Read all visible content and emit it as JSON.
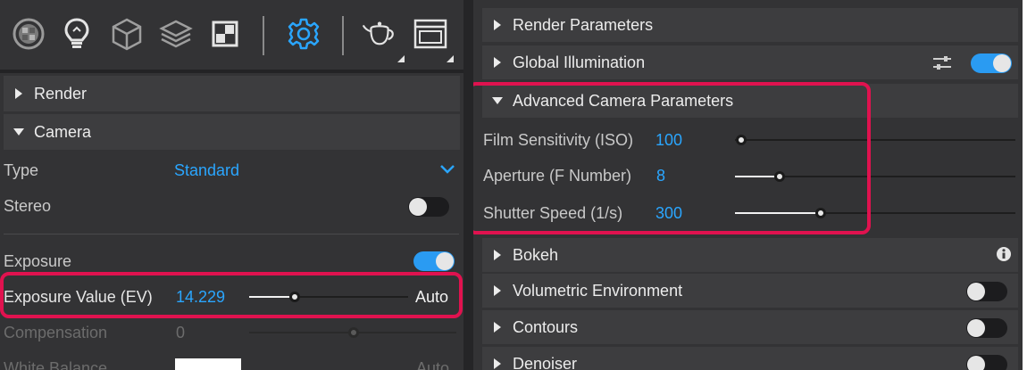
{
  "toolbar": {
    "icons": [
      "materials-icon",
      "lightbulb-icon",
      "cube-icon",
      "layers-icon",
      "texture-icon",
      "gear-icon",
      "teapot-icon",
      "window-icon"
    ]
  },
  "left": {
    "sections": {
      "render": "Render",
      "camera": "Camera"
    },
    "type": {
      "label": "Type",
      "value": "Standard"
    },
    "stereo": {
      "label": "Stereo",
      "enabled": false
    },
    "exposure": {
      "label": "Exposure",
      "enabled": true
    },
    "exposure_value": {
      "label": "Exposure Value (EV)",
      "value": "14.229",
      "auto_label": "Auto",
      "slider_fraction": 0.28
    },
    "compensation": {
      "label": "Compensation",
      "value": "0",
      "slider_fraction": 0.5
    },
    "white_balance": {
      "label": "White Balance",
      "auto_label": "Auto"
    }
  },
  "right": {
    "sections": {
      "render_parameters": "Render Parameters",
      "global_illumination": "Global Illumination",
      "advanced_camera": "Advanced Camera Parameters",
      "bokeh": "Bokeh",
      "volumetric": "Volumetric Environment",
      "contours": "Contours",
      "denoiser": "Denoiser"
    },
    "global_illumination_enabled": true,
    "volumetric_enabled": false,
    "contours_enabled": false,
    "denoiser_enabled": false,
    "film_sensitivity": {
      "label": "Film Sensitivity (ISO)",
      "value": "100",
      "slider_fraction": 0.0
    },
    "aperture": {
      "label": "Aperture (F Number)",
      "value": "8",
      "slider_fraction": 0.16
    },
    "shutter_speed": {
      "label": "Shutter Speed (1/s)",
      "value": "300",
      "slider_fraction": 0.31
    }
  },
  "colors": {
    "accent_blue": "#2aa6ff",
    "highlight_red": "#e0124f",
    "panel_bg": "#333335"
  }
}
